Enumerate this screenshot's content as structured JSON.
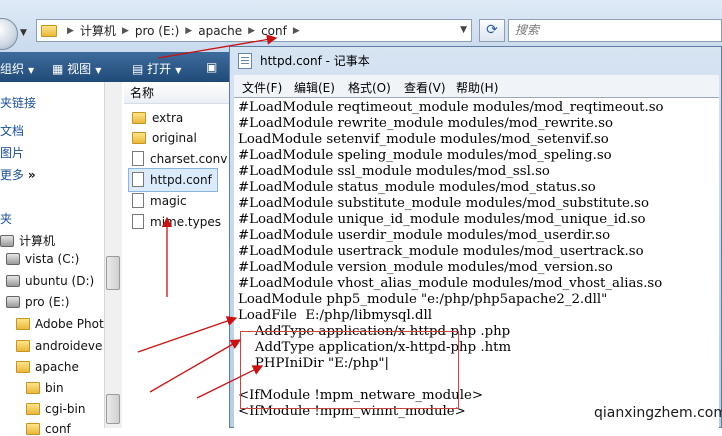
{
  "explorer": {
    "breadcrumb": [
      "计算机",
      "pro (E:)",
      "apache",
      "conf"
    ],
    "search_placeholder": "搜索",
    "toolbar": {
      "organize": "组织",
      "views": "视图",
      "open": "打开"
    },
    "favorites": [
      "夹链接",
      "文档",
      "图片",
      "更多"
    ],
    "favorites_more_glyph": "»",
    "tree_header": "夹",
    "tree": [
      "计算机",
      "vista (C:)",
      "ubuntu (D:)",
      "pro (E:)",
      "Adobe Phot",
      "androideve",
      "apache",
      "bin",
      "cgi-bin",
      "conf"
    ],
    "column_header": "名称",
    "files": [
      "extra",
      "original",
      "charset.conv",
      "httpd.conf",
      "magic",
      "mime.types"
    ]
  },
  "notepad": {
    "title": "httpd.conf - 记事本",
    "menus": [
      "文件(F)",
      "编辑(E)",
      "格式(O)",
      "查看(V)",
      "帮助(H)"
    ],
    "lines": [
      "#LoadModule reqtimeout_module modules/mod_reqtimeout.so",
      "#LoadModule rewrite_module modules/mod_rewrite.so",
      "LoadModule setenvif_module modules/mod_setenvif.so",
      "#LoadModule speling_module modules/mod_speling.so",
      "#LoadModule ssl_module modules/mod_ssl.so",
      "#LoadModule status_module modules/mod_status.so",
      "#LoadModule substitute_module modules/mod_substitute.so",
      "#LoadModule unique_id_module modules/mod_unique_id.so",
      "#LoadModule userdir_module modules/mod_userdir.so",
      "#LoadModule usertrack_module modules/mod_usertrack.so",
      "#LoadModule version_module modules/mod_version.so",
      "#LoadModule vhost_alias_module modules/mod_vhost_alias.so",
      "LoadModule php5_module \"e:/php/php5apache2_2.dll\"",
      "LoadFile  E:/php/libmysql.dll",
      "    AddType application/x-httpd-php .php",
      "    AddType application/x-httpd-php .htm",
      "    PHPIniDir \"E:/php\"|",
      "",
      "<IfModule !mpm_netware_module>",
      "<IfModule !mpm_winnt_module>"
    ]
  },
  "watermark": "qianxingzhem.com",
  "colors": {
    "annotation": "#cc1111",
    "toolbar": "#2a5686"
  }
}
